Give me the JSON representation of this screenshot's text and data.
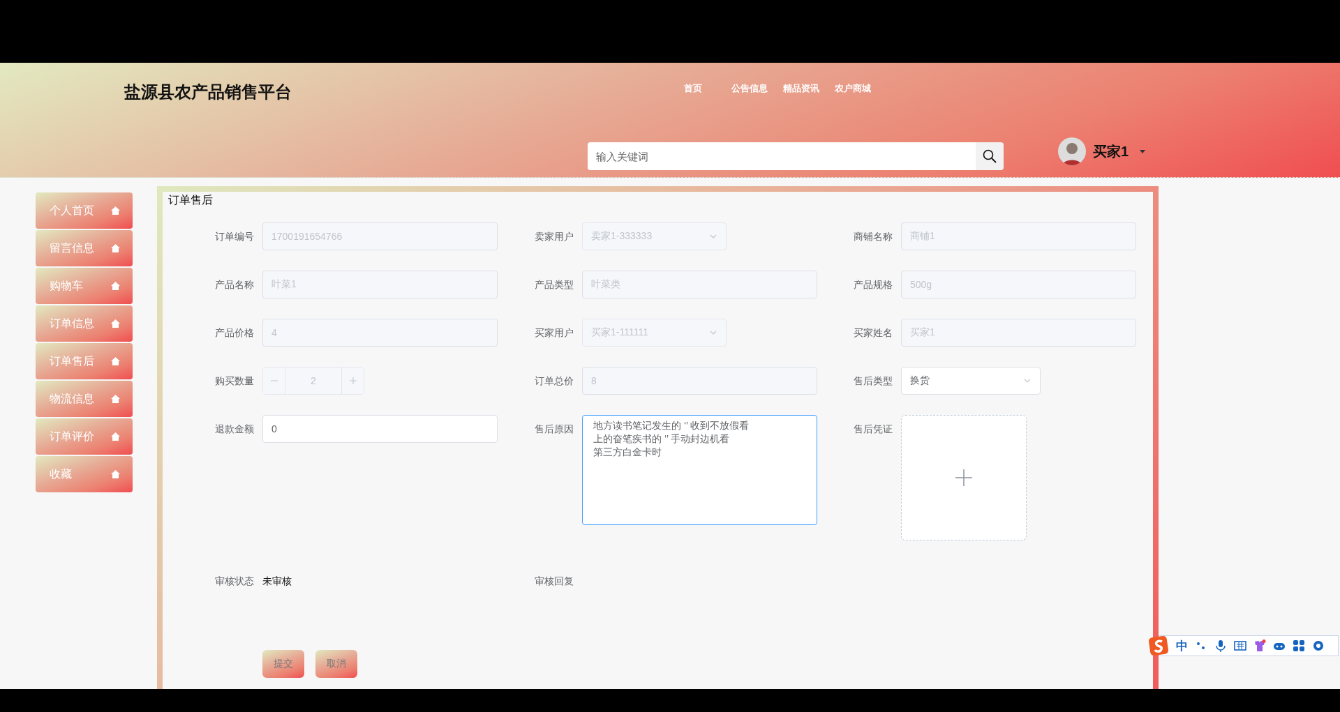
{
  "header": {
    "title": "盐源县农产品销售平台",
    "nav": [
      {
        "label": "首页"
      },
      {
        "label": "公告信息"
      },
      {
        "label": "精品资讯"
      },
      {
        "label": "农户商城"
      }
    ],
    "search": {
      "placeholder": "输入关键词"
    },
    "user": {
      "name": "买家1"
    }
  },
  "sidebar": {
    "items": [
      {
        "label": "个人首页"
      },
      {
        "label": "留言信息"
      },
      {
        "label": "购物车"
      },
      {
        "label": "订单信息"
      },
      {
        "label": "订单售后"
      },
      {
        "label": "物流信息"
      },
      {
        "label": "订单评价"
      },
      {
        "label": "收藏"
      }
    ]
  },
  "form": {
    "title": "订单售后",
    "fields": [
      {
        "label": "订单编号",
        "kind": "text",
        "value": "1700191654766",
        "disabled": true
      },
      {
        "label": "卖家用户",
        "kind": "select",
        "value": "卖家1-333333",
        "disabled": true
      },
      {
        "label": "商铺名称",
        "kind": "text",
        "value": "商铺1",
        "disabled": true
      },
      {
        "label": "产品名称",
        "kind": "text",
        "value": "叶菜1",
        "disabled": true
      },
      {
        "label": "产品类型",
        "kind": "text",
        "value": "叶菜类",
        "disabled": true
      },
      {
        "label": "产品规格",
        "kind": "text",
        "value": "500g",
        "disabled": true
      },
      {
        "label": "产品价格",
        "kind": "text",
        "value": "4",
        "disabled": true
      },
      {
        "label": "买家用户",
        "kind": "select",
        "value": "买家1-111111",
        "disabled": true
      },
      {
        "label": "买家姓名",
        "kind": "text",
        "value": "买家1",
        "disabled": true
      },
      {
        "label": "购买数量",
        "kind": "number",
        "value": "2",
        "disabled": true
      },
      {
        "label": "订单总价",
        "kind": "text",
        "value": "8",
        "disabled": true
      },
      {
        "label": "售后类型",
        "kind": "select",
        "value": "换货",
        "disabled": false
      },
      {
        "label": "退款金额",
        "kind": "text",
        "value": "0",
        "disabled": false
      },
      {
        "label": "售后原因",
        "kind": "textarea",
        "lines": [
          "地方读书笔记发生的 ‘’ 收到不放假看",
          "上的奋笔疾书的 ‘’ 手动封边机看",
          "第三方白金卡时"
        ]
      },
      {
        "label": "售后凭证",
        "kind": "upload"
      },
      {
        "label": "审核状态",
        "kind": "static",
        "value": "未审核"
      },
      {
        "label": "审核回复",
        "kind": "static"
      }
    ],
    "buttons": [
      {
        "label": "提交"
      },
      {
        "label": "取消"
      }
    ]
  },
  "ime_toolbar": {
    "mode": "中"
  }
}
